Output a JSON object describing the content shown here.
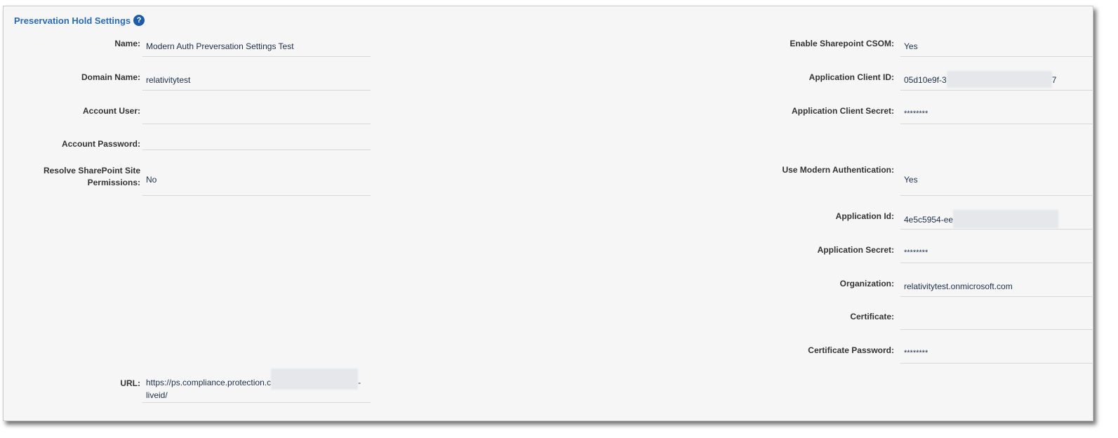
{
  "section": {
    "title": "Preservation Hold Settings",
    "help_icon": "question-circle-icon"
  },
  "left_fields": {
    "name": {
      "label": "Name:",
      "value": "Modern Auth Preversation Settings Test"
    },
    "domain_name": {
      "label": "Domain Name:",
      "value": "relativitytest"
    },
    "account_user": {
      "label": "Account User:",
      "value": ""
    },
    "account_password": {
      "label": "Account Password:",
      "value": ""
    },
    "resolve_sp": {
      "label_line1": "Resolve SharePoint Site",
      "label_line2": "Permissions:",
      "value": "No"
    },
    "url": {
      "label": "URL:",
      "value_part1": "https://ps.compliance.protection.c",
      "value_part2": "-",
      "value_line2": "liveid/"
    }
  },
  "right_fields": {
    "enable_csom": {
      "label": "Enable Sharepoint CSOM:",
      "value": "Yes"
    },
    "app_client_id": {
      "label": "Application Client ID:",
      "value_start": "05d10e9f-3",
      "value_end": "7"
    },
    "app_client_secret": {
      "label": "Application Client Secret:",
      "value": "********"
    },
    "use_modern_auth": {
      "label": "Use Modern Authentication:",
      "value": "Yes"
    },
    "app_id": {
      "label": "Application Id:",
      "value_start": "4e5c5954-ee"
    },
    "app_secret": {
      "label": "Application Secret:",
      "value": "********"
    },
    "organization": {
      "label": "Organization:",
      "value": "relativitytest.onmicrosoft.com"
    },
    "certificate": {
      "label": "Certificate:",
      "value": ""
    },
    "cert_password": {
      "label": "Certificate Password:",
      "value": "********"
    }
  }
}
